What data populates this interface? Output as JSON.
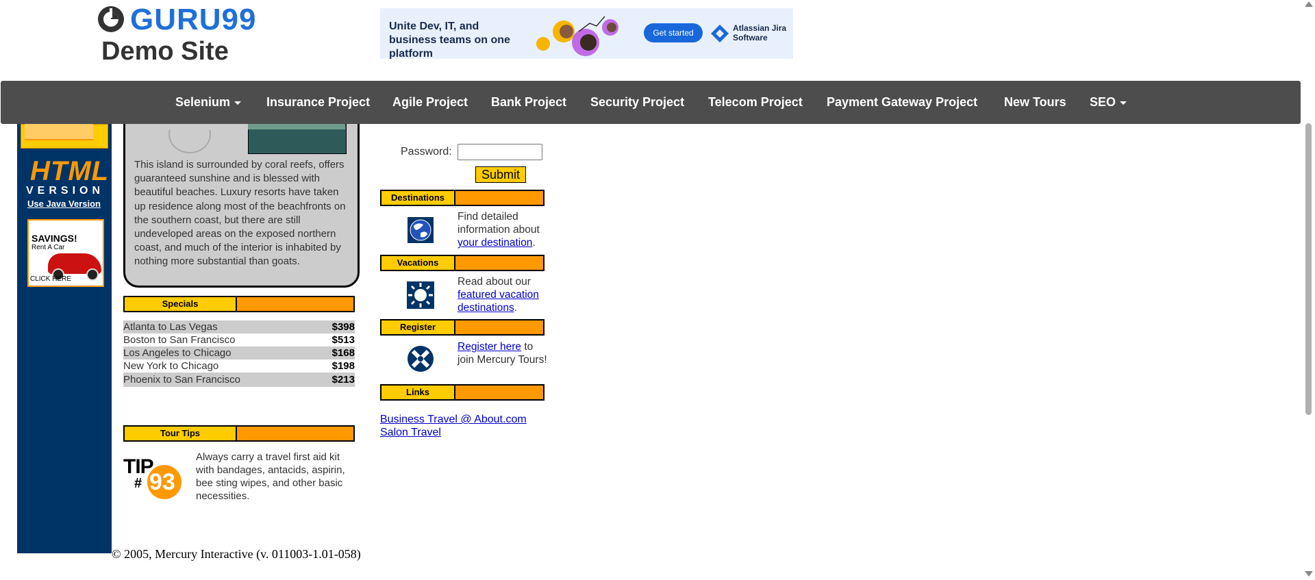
{
  "header": {
    "logo_name": "GURU99",
    "logo_sub": "Demo Site",
    "banner": {
      "text": "Unite Dev, IT, and business teams on one platform",
      "button": "Get started",
      "brand": "Atlassian Jira Software"
    }
  },
  "nav": {
    "items": [
      {
        "label": "Selenium",
        "dropdown": true
      },
      {
        "label": "Insurance Project"
      },
      {
        "label": "Agile Project"
      },
      {
        "label": "Bank Project"
      },
      {
        "label": "Security Project"
      },
      {
        "label": "Telecom Project"
      },
      {
        "label": "Payment Gateway Project"
      },
      {
        "label": "New Tours"
      },
      {
        "label": "SEO",
        "dropdown": true
      }
    ]
  },
  "sidebar": {
    "html_badge_big": "HTML",
    "html_badge_small": "VERSION",
    "java_link": "Use Java Version",
    "savings_title": "SAVINGS!",
    "savings_sub": "Rent A Car",
    "savings_cta": "CLICK HERE"
  },
  "island": {
    "text": "This island is surrounded by coral reefs, offers guaranteed sunshine and is blessed with beautiful beaches. Luxury resorts have taken up residence along most of the beachfronts on the southern coast, but there are still undeveloped areas on the exposed northern coast, and much of the interior is inhabited by nothing more substantial than goats."
  },
  "specials": {
    "title": "Specials",
    "rows": [
      {
        "route": "Atlanta to Las Vegas",
        "price": "$398"
      },
      {
        "route": "Boston to San Francisco",
        "price": "$513"
      },
      {
        "route": "Los Angeles to Chicago",
        "price": "$168"
      },
      {
        "route": "New York to Chicago",
        "price": "$198"
      },
      {
        "route": "Phoenix to San Francisco",
        "price": "$213"
      }
    ]
  },
  "tour_tips": {
    "title": "Tour Tips",
    "logo_tip": "TIP",
    "logo_hash": "#",
    "logo_num": "93",
    "text": "Always carry a travel first aid kit with bandages, antacids, aspirin, bee sting wipes, and other basic necessities."
  },
  "login": {
    "password_label": "Password:",
    "password_value": "",
    "submit": "Submit"
  },
  "destinations": {
    "title": "Destinations",
    "pre": "Find detailed information about ",
    "link": "your destination",
    "post": "."
  },
  "vacations": {
    "title": "Vacations",
    "pre": "Read about our ",
    "link": "featured vacation destinations",
    "post": "."
  },
  "register": {
    "title": "Register",
    "link": "Register here",
    "post": " to join Mercury Tours!"
  },
  "links": {
    "title": "Links",
    "items": [
      "Business Travel @ About.com",
      "Salon Travel"
    ]
  },
  "footer": "© 2005, Mercury Interactive (v. 011003-1.01-058)",
  "colors": {
    "nav_bg": "#4d4d4d",
    "sidebar_bg": "#003366",
    "accent_yellow": "#ffcc00",
    "accent_orange": "#ff9900",
    "link": "#0000cc",
    "logo_blue": "#1e6fd9"
  }
}
